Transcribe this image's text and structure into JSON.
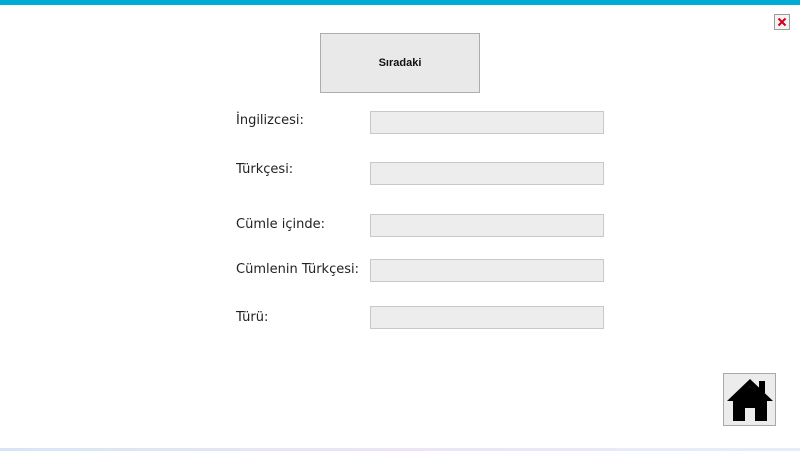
{
  "window": {
    "accent_color": "#00acd6",
    "close_icon": "close-icon"
  },
  "next_button": {
    "label": "Sıradaki"
  },
  "form": {
    "fields": [
      {
        "label": "İngilizcesi:",
        "value": ""
      },
      {
        "label": "Türkçesi:",
        "value": ""
      },
      {
        "label": "Cümle içinde:",
        "value": ""
      },
      {
        "label": "Cümlenin Türkçesi:",
        "value": ""
      },
      {
        "label": "Türü:",
        "value": ""
      }
    ]
  },
  "home_button": {
    "icon": "home-icon"
  }
}
